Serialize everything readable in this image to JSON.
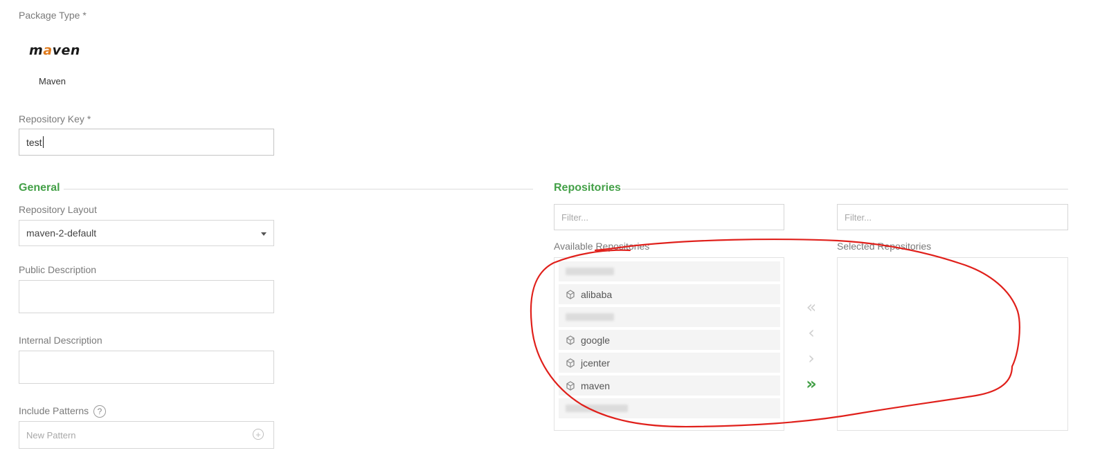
{
  "package_type": {
    "label": "Package Type *",
    "logo_text_pre": "m",
    "logo_text_accent": "a",
    "logo_text_post": "ven",
    "name": "Maven"
  },
  "repository_key": {
    "label": "Repository Key *",
    "value": "test"
  },
  "general": {
    "title": "General",
    "layout_label": "Repository Layout",
    "layout_value": "maven-2-default",
    "public_description_label": "Public Description",
    "public_description_value": "",
    "internal_description_label": "Internal Description",
    "internal_description_value": "",
    "include_patterns_label": "Include Patterns",
    "include_patterns_placeholder": "New Pattern"
  },
  "repositories": {
    "title": "Repositories",
    "available_filter_placeholder": "Filter...",
    "selected_filter_placeholder": "Filter...",
    "available_label": "Available Repositories",
    "selected_label": "Selected Repositories",
    "available_items": [
      "",
      "alibaba",
      "",
      "google",
      "jcenter",
      "maven",
      ""
    ],
    "controls": {
      "remove_all": "«",
      "remove_one": "‹",
      "add_one": "›",
      "add_all": "»"
    }
  },
  "colors": {
    "accent": "#43a047",
    "annotation": "#e0201b"
  },
  "icons": {
    "help": "question-circle-icon",
    "add_pattern": "plus-circle-icon",
    "repo": "repository-icon",
    "select_arrow": "caret-down-icon"
  }
}
